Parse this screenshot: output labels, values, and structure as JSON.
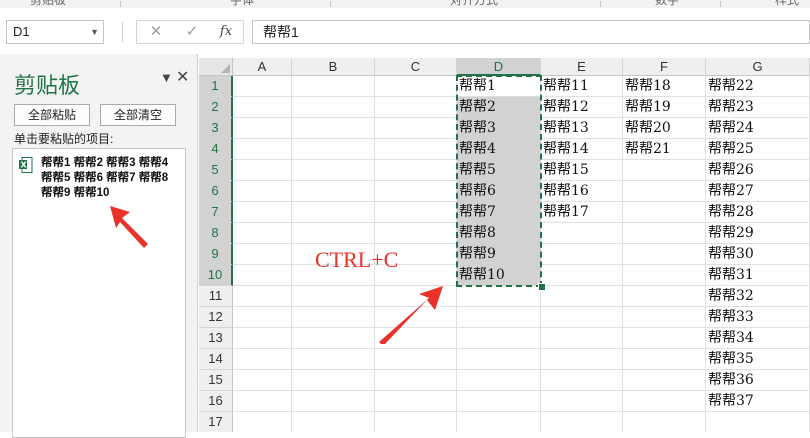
{
  "ribbon_fragments": [
    "剪贴板",
    "字体",
    "对齐方式",
    "数字",
    "样式"
  ],
  "formula_bar": {
    "name_box": "D1",
    "cancel_symbol": "✕",
    "enter_symbol": "✓",
    "fx_label": "fx",
    "formula": "帮帮1"
  },
  "clipboard": {
    "title": "剪贴板",
    "paste_all": "全部粘贴",
    "clear_all": "全部清空",
    "hint": "单击要粘贴的项目:",
    "item_text": "帮帮1 帮帮2 帮帮3 帮帮4 帮帮5 帮帮6 帮帮7 帮帮8 帮帮9 帮帮10"
  },
  "sheet": {
    "columns": [
      "A",
      "B",
      "C",
      "D",
      "E",
      "F",
      "G"
    ],
    "selected_column": "D",
    "rows": [
      "1",
      "2",
      "3",
      "4",
      "5",
      "6",
      "7",
      "8",
      "9",
      "10",
      "11",
      "12",
      "13",
      "14",
      "15",
      "16",
      "17"
    ],
    "col_D": [
      "帮帮1",
      "帮帮2",
      "帮帮3",
      "帮帮4",
      "帮帮5",
      "帮帮6",
      "帮帮7",
      "帮帮8",
      "帮帮9",
      "帮帮10"
    ],
    "col_E": [
      "帮帮11",
      "帮帮12",
      "帮帮13",
      "帮帮14",
      "帮帮15",
      "帮帮16",
      "帮帮17"
    ],
    "col_F": [
      "帮帮18",
      "帮帮19",
      "帮帮20",
      "帮帮21"
    ],
    "col_G": [
      "帮帮22",
      "帮帮23",
      "帮帮24",
      "帮帮25",
      "帮帮26",
      "帮帮27",
      "帮帮28",
      "帮帮29",
      "帮帮30",
      "帮帮31",
      "帮帮32",
      "帮帮33",
      "帮帮34",
      "帮帮35",
      "帮帮36",
      "帮帮37"
    ]
  },
  "annotation": {
    "shortcut": "CTRL+C",
    "color": "#e8322a"
  },
  "colors": {
    "accent": "#217346",
    "selection": "#d2d2d2",
    "pane": "#f3f3f3"
  }
}
